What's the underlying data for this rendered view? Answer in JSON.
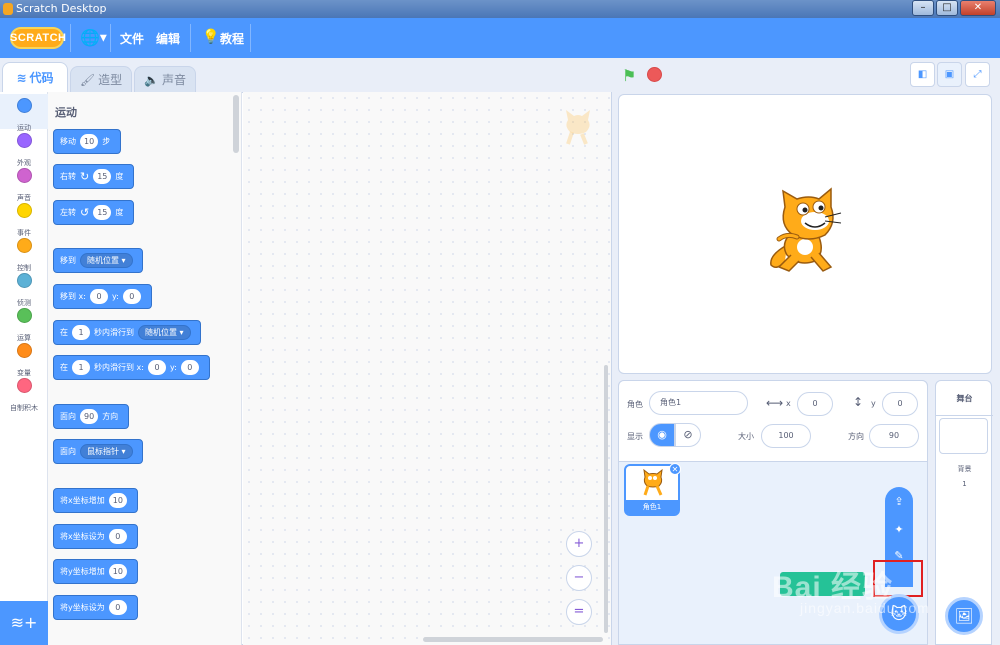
{
  "window": {
    "title": "Scratch Desktop",
    "minimize": "–",
    "maximize": "□",
    "close": "✕"
  },
  "menubar": {
    "logo": "SCRATCH",
    "language_icon": "🌐",
    "file": "文件",
    "edit": "编辑",
    "tutorials": "教程",
    "accent": "#4c97ff"
  },
  "tabs": [
    {
      "label": "代码",
      "icon": "code-icon",
      "active": true
    },
    {
      "label": "造型",
      "icon": "brush-icon"
    },
    {
      "label": "声音",
      "icon": "speaker-icon"
    }
  ],
  "categories": [
    {
      "label": "运动",
      "color": "#4c97ff"
    },
    {
      "label": "外观",
      "color": "#9966ff"
    },
    {
      "label": "声音",
      "color": "#cf63cf"
    },
    {
      "label": "事件",
      "color": "#ffd500"
    },
    {
      "label": "控制",
      "color": "#ffab19"
    },
    {
      "label": "侦测",
      "color": "#5cb1d6"
    },
    {
      "label": "运算",
      "color": "#59c059"
    },
    {
      "label": "变量",
      "color": "#ff8c1a"
    },
    {
      "label": "自制积木",
      "color": "#ff6680"
    }
  ],
  "palette": {
    "section": "运动",
    "blocks": {
      "move": {
        "a": "移动",
        "v": "10",
        "b": "步"
      },
      "turn_right": {
        "a": "右转",
        "v": "15",
        "b": "度"
      },
      "turn_left": {
        "a": "左转",
        "v": "15",
        "b": "度"
      },
      "goto": {
        "a": "移到",
        "d": "随机位置 ▾"
      },
      "goto_xy": {
        "a": "移到 x:",
        "x": "0",
        "b": "y:",
        "y": "0"
      },
      "glide": {
        "a": "在",
        "v": "1",
        "b": "秒内滑行到",
        "d": "随机位置 ▾"
      },
      "glide_xy": {
        "a": "在",
        "v": "1",
        "b": "秒内滑行到 x:",
        "x": "0",
        "c": "y:",
        "y": "0"
      },
      "point": {
        "a": "面向",
        "v": "90",
        "b": "方向"
      },
      "point_towards": {
        "a": "面向",
        "d": "鼠标指针 ▾"
      },
      "change_x": {
        "a": "将x坐标增加",
        "v": "10"
      },
      "set_x": {
        "a": "将x坐标设为",
        "v": "0"
      },
      "change_y": {
        "a": "将y坐标增加",
        "v": "10"
      },
      "set_y": {
        "a": "将y坐标设为",
        "v": "0"
      }
    }
  },
  "script_area": {
    "zoom_in": "+",
    "zoom_out": "−",
    "reset": "="
  },
  "stage_controls": {
    "flag": "⚑"
  },
  "sprite_info": {
    "sprite_label": "角色",
    "sprite_name": "角色1",
    "x_label": "x",
    "x_value": "0",
    "y_label": "y",
    "y_value": "0",
    "show_label": "显示",
    "size_label": "大小",
    "size_value": "100",
    "direction_label": "方向",
    "direction_value": "90"
  },
  "sprites": [
    {
      "name": "角色1",
      "selected": true
    }
  ],
  "stage_panel": {
    "title": "舞台",
    "backdrops_label": "背景",
    "backdrops_count": "1"
  },
  "watermark": {
    "text": "Bai 经验",
    "url": "jingyan.baidu.com"
  }
}
